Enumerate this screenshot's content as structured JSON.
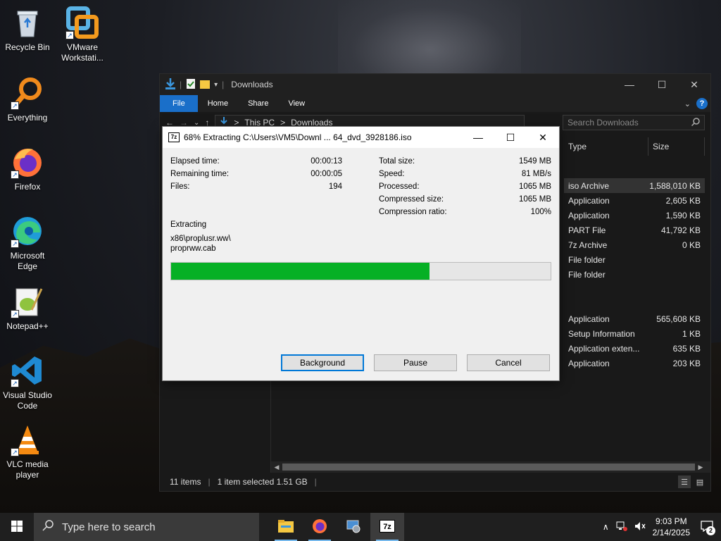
{
  "desktop": {
    "icons": [
      {
        "label": "Recycle Bin",
        "icon": "recycle-bin-icon"
      },
      {
        "label": "VMware Workstati...",
        "icon": "vmware-icon"
      },
      {
        "label": "Everything",
        "icon": "everything-search-icon"
      },
      {
        "label": "Firefox",
        "icon": "firefox-icon"
      },
      {
        "label": "Microsoft Edge",
        "icon": "edge-icon"
      },
      {
        "label": "Notepad++",
        "icon": "notepadpp-icon"
      },
      {
        "label": "Visual Studio Code",
        "icon": "vscode-icon"
      },
      {
        "label": "VLC media player",
        "icon": "vlc-icon"
      }
    ]
  },
  "explorer": {
    "title": "Downloads",
    "ribbon": {
      "file": "File",
      "home": "Home",
      "share": "Share",
      "view": "View"
    },
    "address": {
      "this_pc": "This PC",
      "sep": ">",
      "folder": "Downloads"
    },
    "search_placeholder": "Search Downloads",
    "columns": {
      "type": "Type",
      "size": "Size"
    },
    "rows": [
      {
        "type": "iso Archive",
        "size": "1,588,010 KB",
        "selected": true
      },
      {
        "type": "Application",
        "size": "2,605 KB"
      },
      {
        "type": "Application",
        "size": "1,590 KB"
      },
      {
        "type": "PART File",
        "size": "41,792 KB"
      },
      {
        "type": "7z Archive",
        "size": "0 KB"
      },
      {
        "type": "File folder",
        "size": ""
      },
      {
        "type": "File folder",
        "size": ""
      },
      {
        "type": "Application",
        "size": "565,608 KB"
      },
      {
        "type": "Setup Information",
        "size": "1 KB"
      },
      {
        "type": "Application exten...",
        "size": "635 KB"
      },
      {
        "type": "Application",
        "size": "203 KB"
      }
    ],
    "status": {
      "items": "11 items",
      "selected": "1 item selected  1.51 GB"
    }
  },
  "dialog": {
    "logo": "7z",
    "title": "68% Extracting C:\\Users\\VM5\\Downl ... 64_dvd_3928186.iso",
    "left": [
      {
        "k": "Elapsed time:",
        "v": "00:00:13"
      },
      {
        "k": "Remaining time:",
        "v": "00:00:05"
      },
      {
        "k": "Files:",
        "v": "194"
      }
    ],
    "right": [
      {
        "k": "Total size:",
        "v": "1549 MB"
      },
      {
        "k": "Speed:",
        "v": "81 MB/s"
      },
      {
        "k": "Processed:",
        "v": "1065 MB"
      },
      {
        "k": "Compressed size:",
        "v": "1065 MB"
      },
      {
        "k": "Compression ratio:",
        "v": "100%"
      }
    ],
    "extracting_label": "Extracting",
    "path_line1": "x86\\proplusr.ww\\",
    "path_line2": "proprww.cab",
    "progress": 0.68,
    "progress_color": "#06b025",
    "buttons": {
      "background": "Background",
      "pause": "Pause",
      "cancel": "Cancel"
    }
  },
  "taskbar": {
    "search_placeholder": "Type here to search",
    "time": "9:03 PM",
    "date": "2/14/2025",
    "notifications": "2",
    "apps": [
      "file-explorer-icon",
      "firefox-icon",
      "control-panel-icon",
      "7zip-icon"
    ]
  }
}
